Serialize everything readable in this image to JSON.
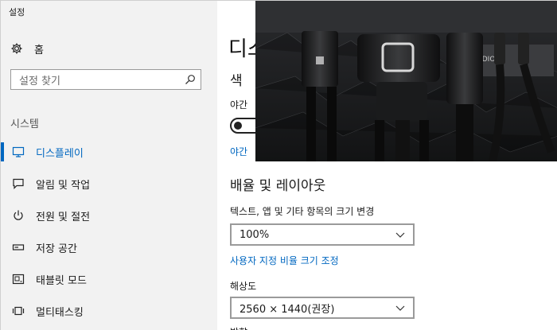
{
  "window": {
    "title": "설정"
  },
  "sidebar": {
    "home_label": "홈",
    "search_placeholder": "설정 찾기",
    "section_label": "시스템",
    "items": [
      {
        "label": "디스플레이",
        "icon": "monitor-icon",
        "active": true
      },
      {
        "label": "알림 및 작업",
        "icon": "chat-icon",
        "active": false
      },
      {
        "label": "전원 및 절전",
        "icon": "power-icon",
        "active": false
      },
      {
        "label": "저장 공간",
        "icon": "storage-icon",
        "active": false
      },
      {
        "label": "태블릿 모드",
        "icon": "tablet-icon",
        "active": false
      },
      {
        "label": "멀티태스킹",
        "icon": "multitask-icon",
        "active": false
      }
    ]
  },
  "main": {
    "page_title": "디스",
    "color_heading": "색",
    "night_light_label": "야간",
    "night_light_link": "야간",
    "scale_heading": "배율 및 레이아웃",
    "scale_label": "텍스트, 앱 및 기타 항목의 크기 변경",
    "scale_value": "100%",
    "custom_scale_link": "사용자 지정 비율 크기 조정",
    "resolution_label": "해상도",
    "resolution_value": "2560 × 1440(권장)",
    "cut_label": "방향"
  },
  "colors": {
    "accent": "#0067c0",
    "sidebar_bg": "#f2f2f2"
  }
}
